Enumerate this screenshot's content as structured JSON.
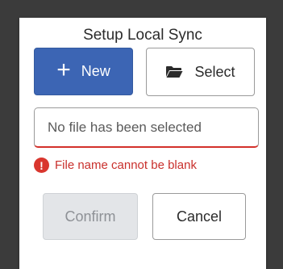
{
  "dialog": {
    "title": "Setup Local Sync",
    "new_button": {
      "icon": "plus-icon",
      "label": "New"
    },
    "select_button": {
      "icon": "folder-icon",
      "label": "Select"
    },
    "file_input": {
      "value": "",
      "placeholder": "No file has been selected"
    },
    "error": {
      "icon": "exclamation-icon",
      "message": "File name cannot be blank"
    },
    "confirm_button": {
      "label": "Confirm",
      "disabled": true
    },
    "cancel_button": {
      "label": "Cancel"
    }
  },
  "colors": {
    "primary": "#3c65b4",
    "error": "#c9302c",
    "disabled_bg": "#e3e5e8",
    "backdrop": "#3b3b3b"
  }
}
